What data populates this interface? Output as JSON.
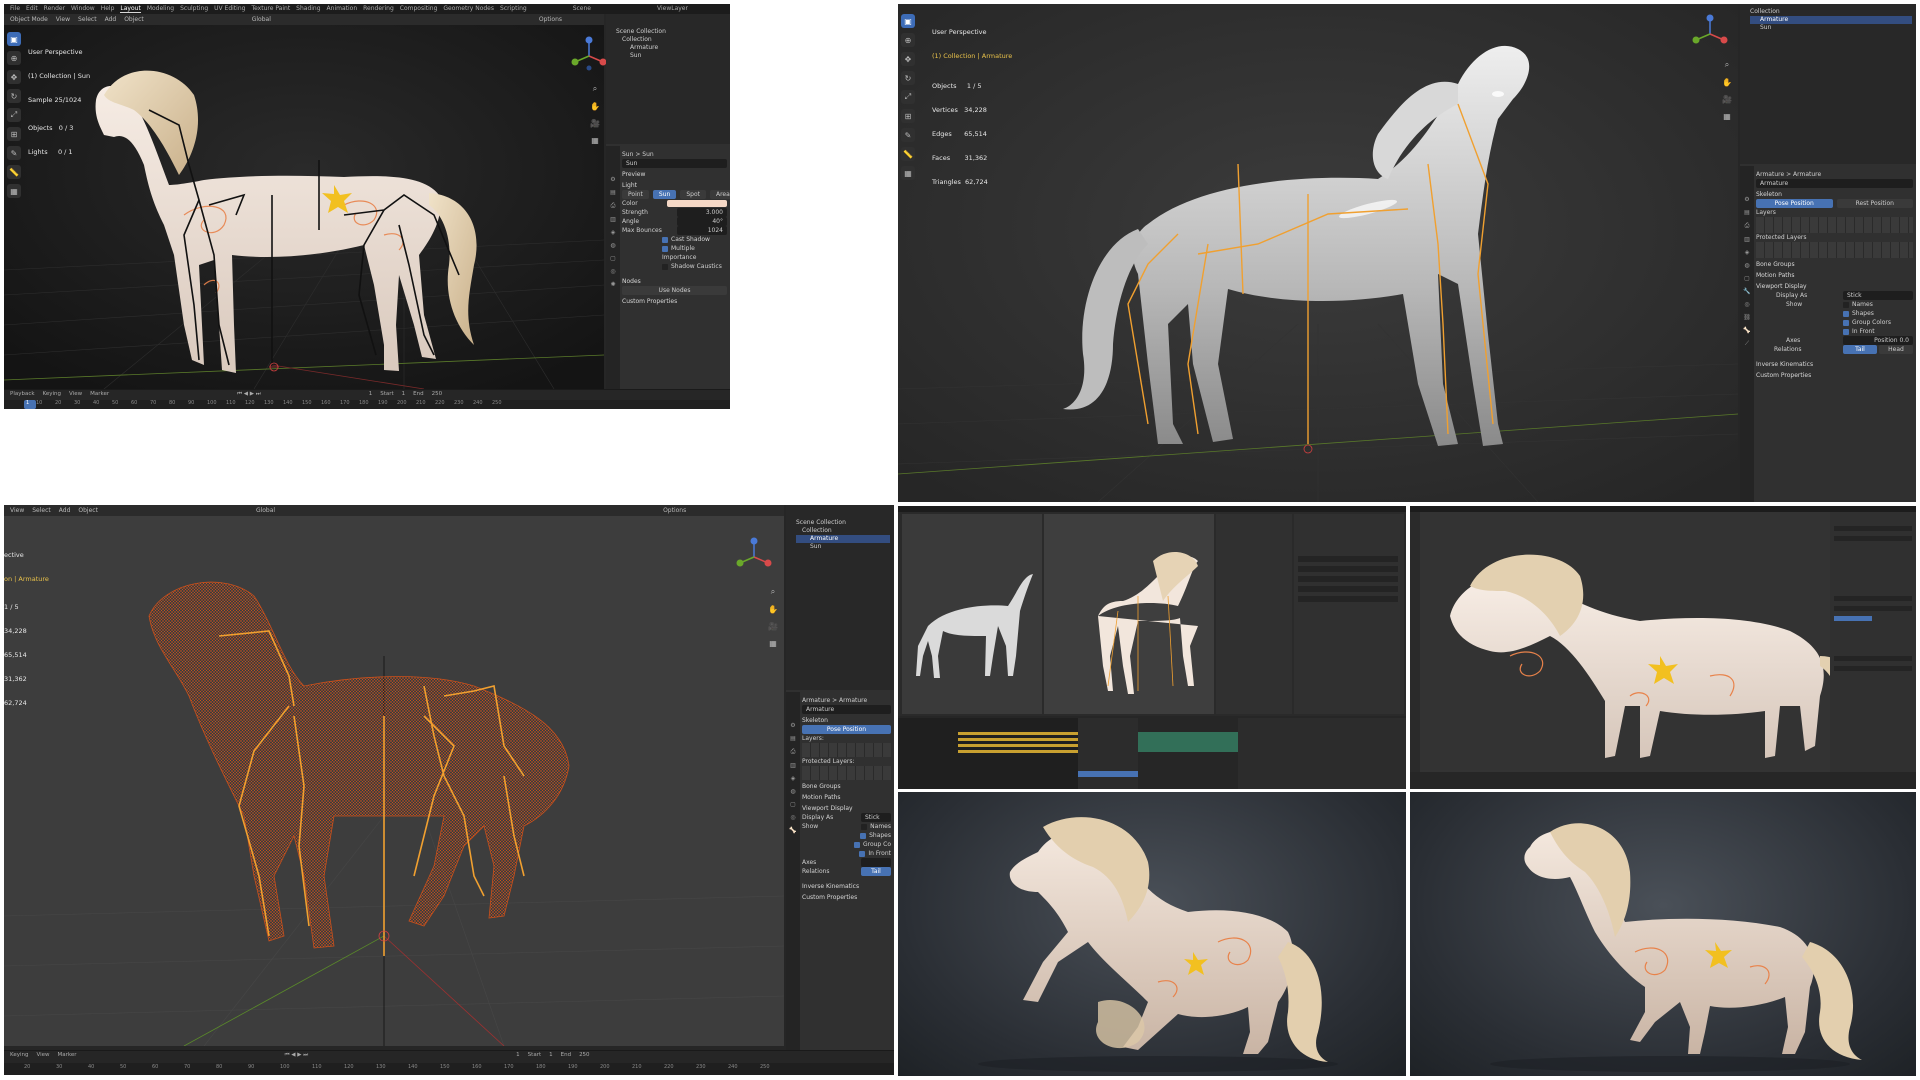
{
  "panel1": {
    "topmenu": [
      "File",
      "Edit",
      "Render",
      "Window",
      "Help",
      "Layout",
      "Modeling",
      "Sculpting",
      "UV Editing",
      "Texture Paint",
      "Shading",
      "Animation",
      "Rendering",
      "Compositing",
      "Geometry Nodes",
      "Scripting",
      "Scene",
      "ViewLayer"
    ],
    "active_tab": "Layout",
    "header": [
      "Object Mode",
      "View",
      "Select",
      "Add",
      "Object",
      "Global",
      "Options"
    ],
    "viewport_info": {
      "line1": "User Perspective",
      "line2": "(1) Collection | Sun",
      "line3": "Sample 25/1024",
      "line4": "Objects   0 / 3",
      "line5": "Lights     0 / 1"
    },
    "outliner": [
      "Scene Collection",
      "Collection",
      "Armature",
      "Sun"
    ],
    "props": {
      "breadcrumb": "Sun  >  Sun",
      "name": "Sun",
      "preview": "Preview",
      "light": "Light",
      "light_types": [
        "Point",
        "Sun",
        "Spot",
        "Area"
      ],
      "active_type": "Sun",
      "rows": [
        {
          "label": "Color",
          "value": ""
        },
        {
          "label": "Strength",
          "value": "3.000"
        },
        {
          "label": "Angle",
          "value": "40°"
        },
        {
          "label": "Max Bounces",
          "value": "1024"
        }
      ],
      "checks": [
        "Cast Shadow",
        "Multiple Importance",
        "Shadow Caustics"
      ],
      "nodes": "Nodes",
      "use_nodes": "Use Nodes",
      "custom": "Custom Properties"
    },
    "timeline": {
      "controls": [
        "Playback",
        "Keying",
        "View",
        "Marker"
      ],
      "current": "1",
      "start_label": "Start",
      "start": "1",
      "end_label": "End",
      "end": "250",
      "ruler": [
        "10",
        "20",
        "30",
        "40",
        "50",
        "60",
        "70",
        "80",
        "90",
        "100",
        "110",
        "120",
        "130",
        "140",
        "150",
        "160",
        "170",
        "180",
        "190",
        "200",
        "210",
        "220",
        "230",
        "240",
        "250"
      ]
    }
  },
  "panel2": {
    "viewport_info": {
      "line1": "User Perspective",
      "line2": "(1) Collection | Armature",
      "line3": "Objects     1 / 5",
      "line4": "Vertices   34,228",
      "line5": "Edges      65,514",
      "line6": "Faces       31,362",
      "line7": "Triangles  62,724"
    },
    "outliner": [
      "Collection",
      "Armature",
      "Sun"
    ],
    "props": {
      "breadcrumb": "Armature  >  Armature",
      "name": "Armature",
      "skeleton": "Skeleton",
      "pose_position": "Pose Position",
      "rest_position": "Rest Position",
      "layers": "Layers",
      "protected_layers": "Protected Layers",
      "bone_groups": "Bone Groups",
      "motion_paths": "Motion Paths",
      "viewport_display": "Viewport Display",
      "display_as_label": "Display As",
      "display_as": "Stick",
      "show": "Show",
      "show_items": [
        "Names",
        "Shapes",
        "Group Colors",
        "In Front"
      ],
      "axes": "Axes",
      "position": "Position",
      "position_value": "0.0",
      "relations": "Relations",
      "relations_opts": [
        "Tail",
        "Head"
      ],
      "ik": "Inverse Kinematics",
      "custom": "Custom Properties"
    }
  },
  "panel3": {
    "header": [
      "View",
      "Select",
      "Add",
      "Object",
      "Global",
      "Options"
    ],
    "viewport_info": {
      "line1": "ective",
      "line2": "on | Armature",
      "line3": "1 / 5",
      "line4": "34,228",
      "line5": "65,514",
      "line6": "31,362",
      "line7": "62,724"
    },
    "outliner": [
      "Scene Collection",
      "Collection",
      "Armature",
      "Sun"
    ],
    "props": {
      "breadcrumb": "Armature  >  Armature",
      "name": "Armature",
      "skeleton": "Skeleton",
      "pose_position": "Pose Position",
      "layers": "Layers:",
      "protected_layers": "Protected Layers:",
      "bone_groups": "Bone Groups",
      "motion_paths": "Motion Paths",
      "viewport_display": "Viewport Display",
      "display_as_label": "Display As",
      "display_as": "Stick",
      "show": "Show",
      "show_items": [
        "Names",
        "Shapes",
        "Group Co",
        "In Front"
      ],
      "axes": "Axes",
      "relations": "Relations",
      "relations_value": "Tail",
      "ik": "Inverse Kinematics",
      "custom": "Custom Properties"
    },
    "timeline": {
      "controls": [
        "Keying",
        "View",
        "Marker"
      ],
      "current": "1",
      "start_label": "Start",
      "start": "1",
      "end_label": "End",
      "end": "250",
      "ruler": [
        "20",
        "30",
        "40",
        "50",
        "60",
        "70",
        "80",
        "90",
        "100",
        "110",
        "120",
        "130",
        "140",
        "150",
        "160",
        "170",
        "180",
        "190",
        "200",
        "210",
        "220",
        "230",
        "240",
        "250"
      ]
    }
  },
  "colors": {
    "blender_bg": "#262626",
    "panel_bg": "#303030",
    "accent": "#4772b3",
    "bone": "#f0a030",
    "wire": "#c04a20",
    "horse": "#f2e6dc",
    "mane": "#e6d3b5"
  }
}
